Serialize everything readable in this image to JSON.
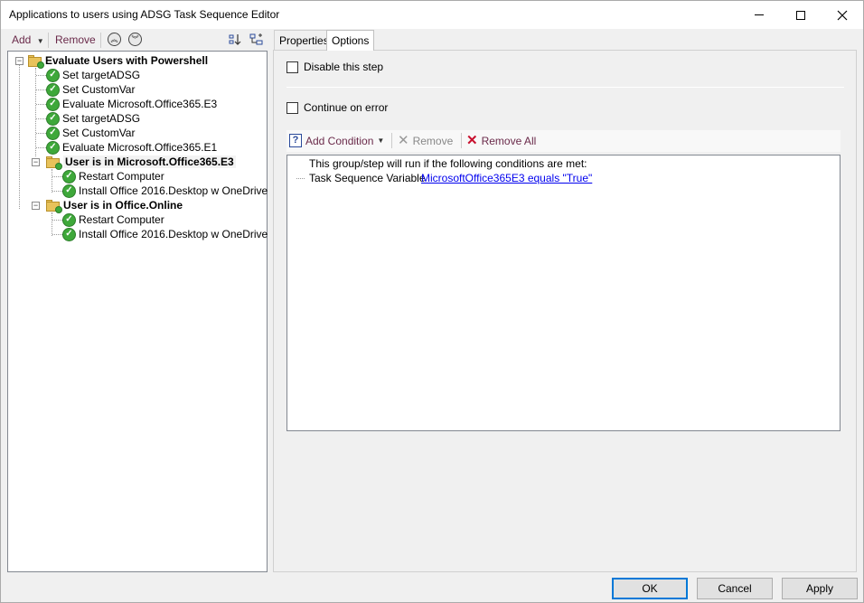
{
  "window": {
    "title": "Applications to users using ADSG Task Sequence Editor"
  },
  "left_toolbar": {
    "add_label": "Add",
    "remove_label": "Remove"
  },
  "tree": [
    {
      "label": "Evaluate Users with Powershell",
      "kind": "group",
      "bold": true
    },
    {
      "label": "Set targetADSG",
      "kind": "step"
    },
    {
      "label": "Set CustomVar",
      "kind": "step"
    },
    {
      "label": "Evaluate Microsoft.Office365.E3",
      "kind": "step"
    },
    {
      "label": "Set targetADSG",
      "kind": "step"
    },
    {
      "label": "Set CustomVar",
      "kind": "step"
    },
    {
      "label": "Evaluate Microsoft.Office365.E1",
      "kind": "step"
    },
    {
      "label": "User is in Microsoft.Office365.E3",
      "kind": "group",
      "bold": true,
      "selected": true
    },
    {
      "label": "Restart Computer",
      "kind": "step"
    },
    {
      "label": "Install Office 2016.Desktop w OneDrive",
      "kind": "step"
    },
    {
      "label": "User is in Office.Online",
      "kind": "group",
      "bold": true
    },
    {
      "label": "Restart Computer",
      "kind": "step"
    },
    {
      "label": "Install Office 2016.Desktop w OneDrive",
      "kind": "step"
    }
  ],
  "tabs": [
    {
      "label": "Properties"
    },
    {
      "label": "Options"
    }
  ],
  "options": {
    "disable_step": "Disable this step",
    "continue_on_error": "Continue on error",
    "add_condition": "Add Condition",
    "remove": "Remove",
    "remove_all": "Remove All",
    "cond_header": "This group/step will run if the following conditions are met:",
    "cond_type": "Task Sequence Variable",
    "cond_link": "MicrosoftOffice365E3 equals \"True\""
  },
  "buttons": {
    "ok": "OK",
    "cancel": "Cancel",
    "apply": "Apply"
  }
}
